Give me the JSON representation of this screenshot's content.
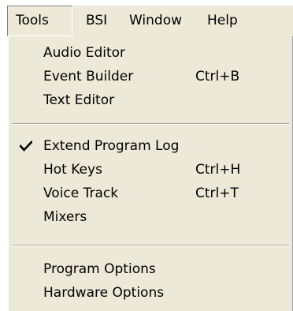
{
  "menubar": {
    "items": [
      {
        "label": "Tools"
      },
      {
        "label": "BSI"
      },
      {
        "label": "Window"
      },
      {
        "label": "Help"
      }
    ]
  },
  "dropdown": {
    "groups": [
      {
        "items": [
          {
            "label": "Audio Editor",
            "shortcut": ""
          },
          {
            "label": "Event Builder",
            "shortcut": "Ctrl+B"
          },
          {
            "label": "Text Editor",
            "shortcut": ""
          }
        ]
      },
      {
        "items": [
          {
            "label": "Extend Program Log",
            "shortcut": "",
            "checked": true,
            "icon": "check-icon"
          },
          {
            "label": "Hot Keys",
            "shortcut": "Ctrl+H"
          },
          {
            "label": "Voice Track",
            "shortcut": "Ctrl+T"
          },
          {
            "label": "Mixers",
            "shortcut": ""
          }
        ]
      },
      {
        "items": [
          {
            "label": "Program Options",
            "shortcut": ""
          },
          {
            "label": "Hardware Options",
            "shortcut": ""
          }
        ]
      }
    ]
  }
}
